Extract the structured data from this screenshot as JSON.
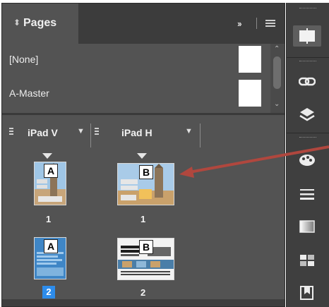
{
  "panel": {
    "tab_title": "Pages",
    "tab_icon": "chevron-updown-icon",
    "collapse_icon": "double-chevron-right-icon",
    "menu_icon": "panel-menu-icon"
  },
  "masters": [
    {
      "label": "[None]"
    },
    {
      "label": "A-Master"
    }
  ],
  "columns": [
    {
      "label": "iPad V"
    },
    {
      "label": "iPad H"
    }
  ],
  "pages": {
    "ipad_v": [
      {
        "master": "A",
        "number": "1",
        "selected": false
      },
      {
        "master": "A",
        "number": "2",
        "selected": true
      }
    ],
    "ipad_h": [
      {
        "master": "B",
        "number": "1",
        "selected": false
      },
      {
        "master": "B",
        "number": "2",
        "selected": false
      }
    ]
  },
  "dock": [
    {
      "icon": "pages-icon",
      "active": true
    },
    {
      "icon": "links-icon",
      "active": false
    },
    {
      "icon": "layers-icon",
      "active": false
    },
    {
      "icon": "swatches-icon",
      "active": false
    },
    {
      "icon": "stroke-icon",
      "active": false
    },
    {
      "icon": "gradient-icon",
      "active": false
    },
    {
      "icon": "swatch-grid-icon",
      "active": false
    },
    {
      "icon": "bookmark-icon",
      "active": false
    }
  ],
  "colors": {
    "panel_bg": "#535353",
    "selection_blue": "#2d8ceb",
    "annotation_arrow": "#b0473e"
  }
}
